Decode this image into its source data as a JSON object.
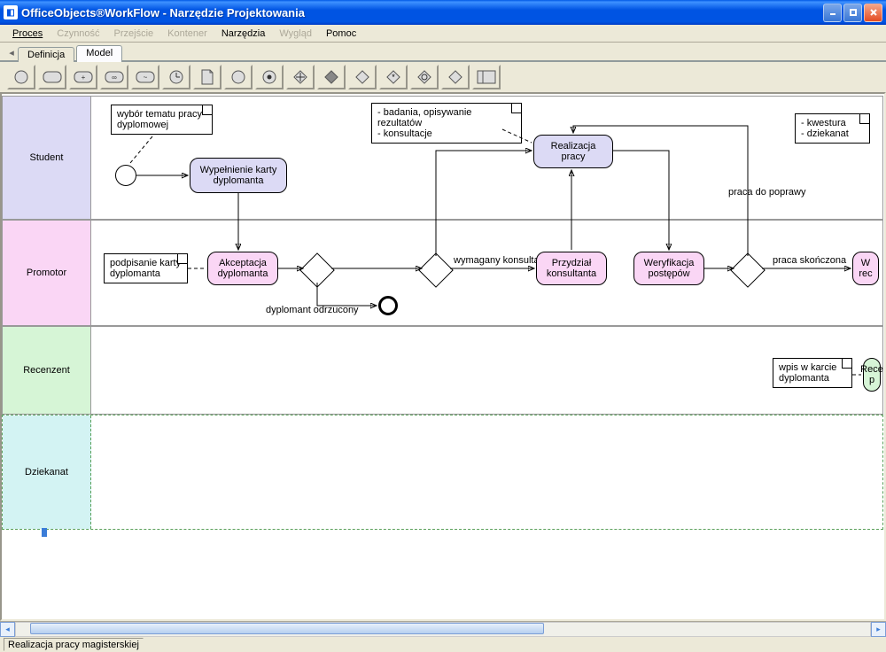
{
  "window": {
    "title": "OfficeObjects®WorkFlow - Narzędzie Projektowania"
  },
  "menu": {
    "items": [
      {
        "label": "Proces",
        "enabled": true,
        "underline": true
      },
      {
        "label": "Czynność",
        "enabled": false
      },
      {
        "label": "Przejście",
        "enabled": false
      },
      {
        "label": "Kontener",
        "enabled": false
      },
      {
        "label": "Narzędzia",
        "enabled": true
      },
      {
        "label": "Wygląd",
        "enabled": false
      },
      {
        "label": "Pomoc",
        "enabled": true
      }
    ]
  },
  "tabs": {
    "items": [
      {
        "label": "Definicja",
        "active": false
      },
      {
        "label": "Model",
        "active": true
      }
    ]
  },
  "toolbar": {
    "icons": [
      "circle-start",
      "rounded-rect",
      "rounded-rect-plus",
      "rounded-rect-tilde",
      "rounded-rect-tilde2",
      "circle-clock",
      "document",
      "circle-thin",
      "circle-dot",
      "diamond-plus",
      "diamond-filled",
      "diamond-outline",
      "diamond-star",
      "diamond-ring",
      "diamond-dot",
      "split-rect"
    ]
  },
  "lanes": {
    "student": "Student",
    "promotor": "Promotor",
    "recenzent": "Recenzent",
    "dziekanat": "Dziekanat"
  },
  "nodes": {
    "note_topic": "wybór tematu pracy dyplomowej",
    "task_fill_card": "Wypełnienie karty dyplomanta",
    "note_research": "- badania, opisywanie rezultatów\n- konsultacje",
    "task_realization": "Realizacja pracy",
    "note_bursar": "- kwestura\n- dziekanat",
    "note_sign_card": "podpisanie karty dyplomanta",
    "task_acceptance": "Akceptacja dyplomanta",
    "task_consultant": "Przydział konsultanta",
    "task_verification": "Weryfikacja postępów",
    "task_rec_partial": "W\nrec",
    "note_rec_entry": "wpis w karcie dyplomanta",
    "task_rec_green": "Rece\np"
  },
  "edge_labels": {
    "rejected": "dyplomant odrzucony",
    "consultant": "wymagany konsultant",
    "to_fix": "praca do poprawy",
    "finished": "praca skończona"
  },
  "status": {
    "text": "Realizacja pracy magisterskiej"
  }
}
